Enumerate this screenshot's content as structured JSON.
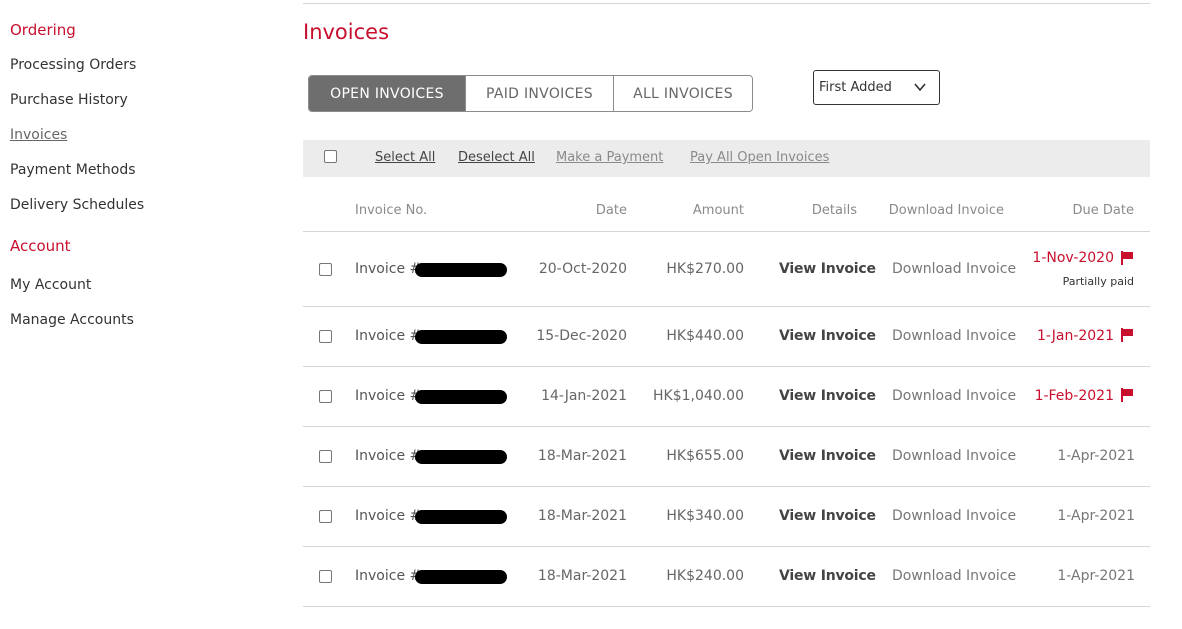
{
  "sidebar": {
    "sections": [
      {
        "title": "Ordering",
        "items": [
          {
            "label": "Processing Orders",
            "active": false
          },
          {
            "label": "Purchase History",
            "active": false
          },
          {
            "label": "Invoices",
            "active": true
          },
          {
            "label": "Payment Methods",
            "active": false
          },
          {
            "label": "Delivery Schedules",
            "active": false
          }
        ]
      },
      {
        "title": "Account",
        "items": [
          {
            "label": "My Account",
            "active": false
          },
          {
            "label": "Manage Accounts",
            "active": false
          }
        ]
      }
    ]
  },
  "page": {
    "title": "Invoices"
  },
  "tabs": [
    {
      "label": "OPEN INVOICES",
      "active": true
    },
    {
      "label": "PAID INVOICES",
      "active": false
    },
    {
      "label": "ALL INVOICES",
      "active": false
    }
  ],
  "sort": {
    "selected": "First Added",
    "icon": "chevron-down-icon"
  },
  "actions": {
    "select_all": "Select All",
    "deselect_all": "Deselect All",
    "make_payment": "Make a Payment",
    "pay_all": "Pay All Open Invoices"
  },
  "table": {
    "headers": {
      "invoice_no": "Invoice No.",
      "date": "Date",
      "amount": "Amount",
      "details": "Details",
      "download": "Download Invoice",
      "due_date": "Due Date"
    },
    "rows": [
      {
        "invoice_prefix": "Invoice #",
        "date": "20-Oct-2020",
        "amount": "HK$270.00",
        "details": "View Invoice",
        "download": "Download Invoice",
        "due_date": "1-Nov-2020",
        "overdue": true,
        "note": "Partially paid"
      },
      {
        "invoice_prefix": "Invoice #",
        "date": "15-Dec-2020",
        "amount": "HK$440.00",
        "details": "View Invoice",
        "download": "Download Invoice",
        "due_date": "1-Jan-2021",
        "overdue": true,
        "note": ""
      },
      {
        "invoice_prefix": "Invoice #",
        "date": "14-Jan-2021",
        "amount": "HK$1,040.00",
        "details": "View Invoice",
        "download": "Download Invoice",
        "due_date": "1-Feb-2021",
        "overdue": true,
        "note": ""
      },
      {
        "invoice_prefix": "Invoice #",
        "date": "18-Mar-2021",
        "amount": "HK$655.00",
        "details": "View Invoice",
        "download": "Download Invoice",
        "due_date": "1-Apr-2021",
        "overdue": false,
        "note": ""
      },
      {
        "invoice_prefix": "Invoice #",
        "date": "18-Mar-2021",
        "amount": "HK$340.00",
        "details": "View Invoice",
        "download": "Download Invoice",
        "due_date": "1-Apr-2021",
        "overdue": false,
        "note": ""
      },
      {
        "invoice_prefix": "Invoice #",
        "date": "18-Mar-2021",
        "amount": "HK$240.00",
        "details": "View Invoice",
        "download": "Download Invoice",
        "due_date": "1-Apr-2021",
        "overdue": false,
        "note": ""
      }
    ]
  },
  "colors": {
    "accent": "#c8102e",
    "active_tab": "#6e6e6e",
    "action_bar": "#ececec",
    "rule": "#d6d6d6"
  }
}
